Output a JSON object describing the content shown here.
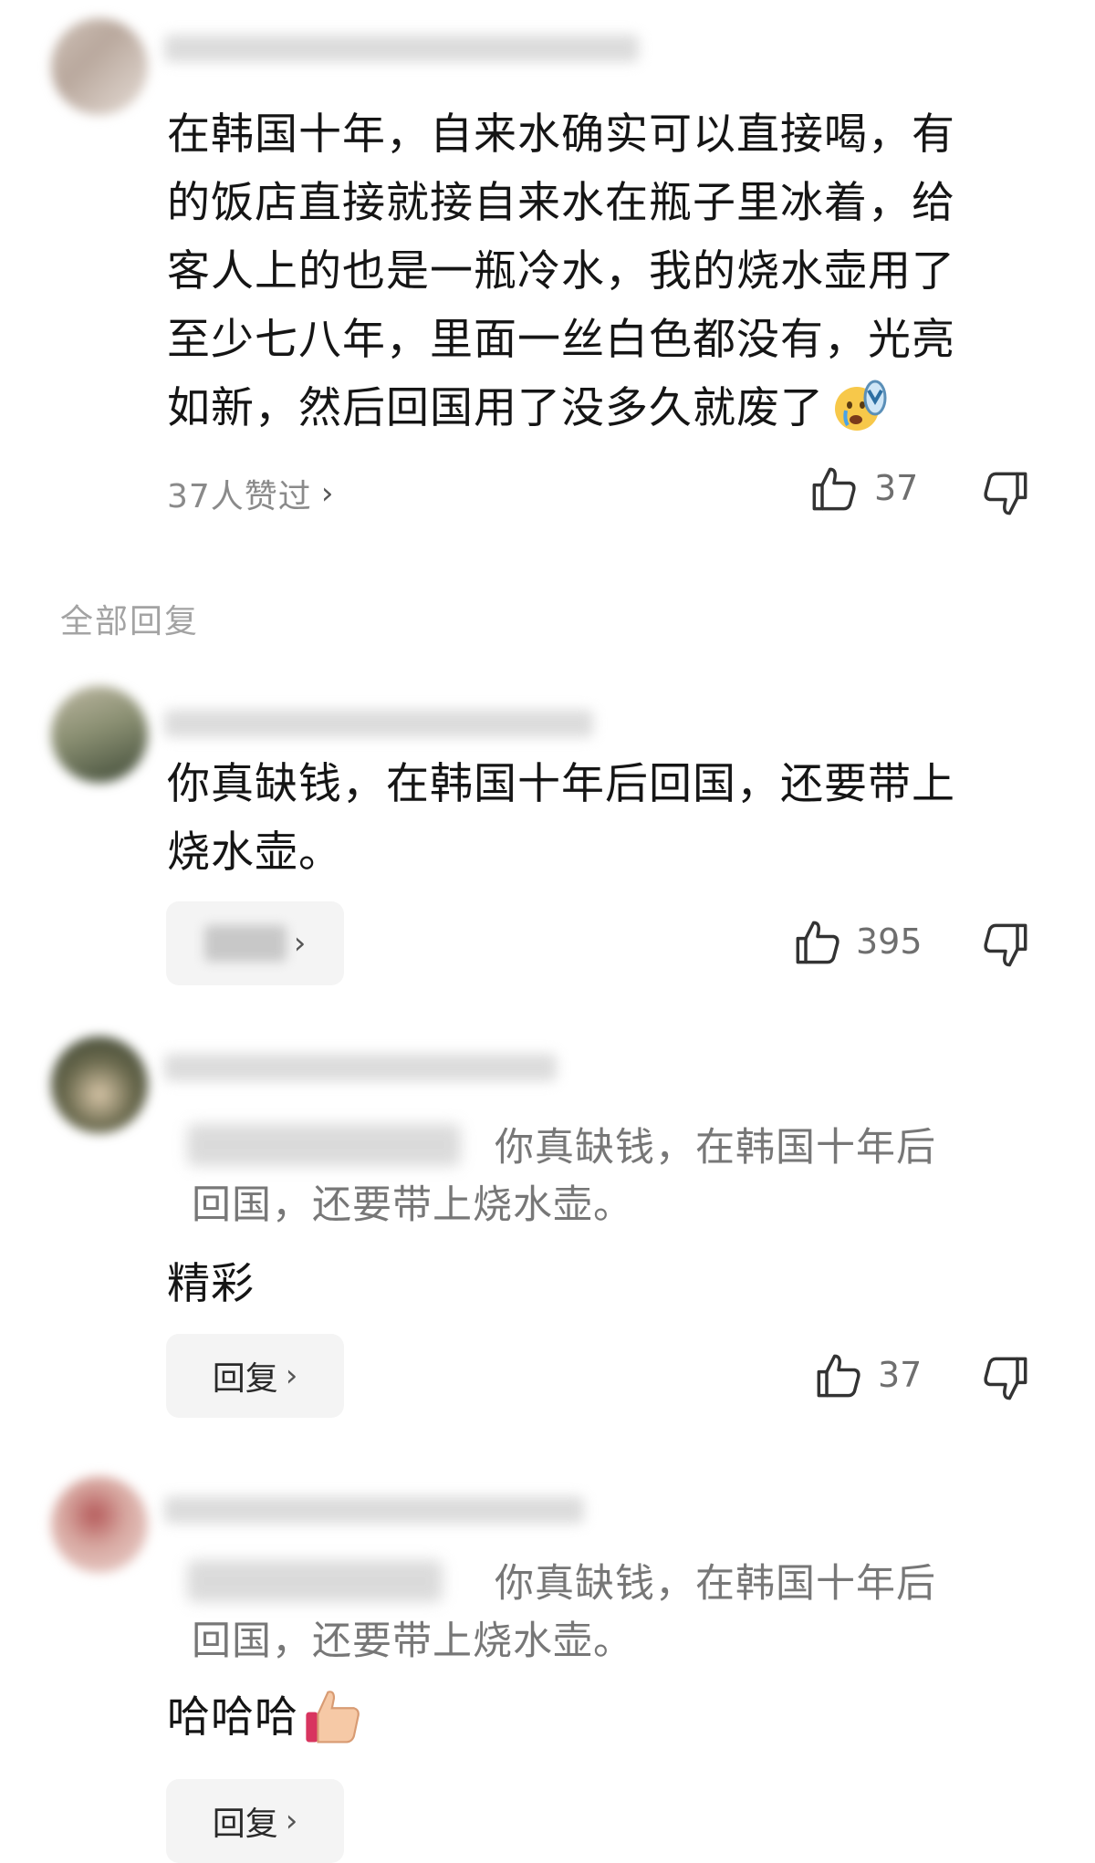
{
  "comment": {
    "text_lines": [
      "在韩国十年，自来水确实可以直接喝，有",
      "的饭店直接就接自来水在瓶子里冰着，给",
      "客人上的也是一瓶冷水，我的烧水壶用了",
      "至少七八年，里面一丝白色都没有，光亮",
      "如新，然后回国用了没多久就废了"
    ],
    "likes_summary": "37人赞过",
    "like_count": "37"
  },
  "section_label": "全部回复",
  "replies": [
    {
      "text_lines": [
        "你真缺钱，在韩国十年后回国，还要带上",
        "烧水壶。"
      ],
      "reply_label": "回复",
      "like_count": "395"
    },
    {
      "quote_lines": [
        "你真缺钱，在韩国十年后",
        "回国，还要带上烧水壶。"
      ],
      "text": "精彩",
      "reply_label": "回复",
      "like_count": "37"
    },
    {
      "quote_lines": [
        "你真缺钱，在韩国十年后",
        "回国，还要带上烧水壶。"
      ],
      "text": "哈哈哈",
      "reply_label": "回复"
    }
  ],
  "icons": {
    "like": "thumbs-up-icon",
    "dislike": "thumbs-down-icon",
    "chevron": "chevron-right-icon",
    "emoji_1": "crying-face-slipper-emoji",
    "emoji_2": "thumbs-up-emoji"
  },
  "colors": {
    "body_text": "#151515",
    "muted": "#8a8a8a",
    "quote": "#777777",
    "button_bg": "#f4f4f4"
  }
}
